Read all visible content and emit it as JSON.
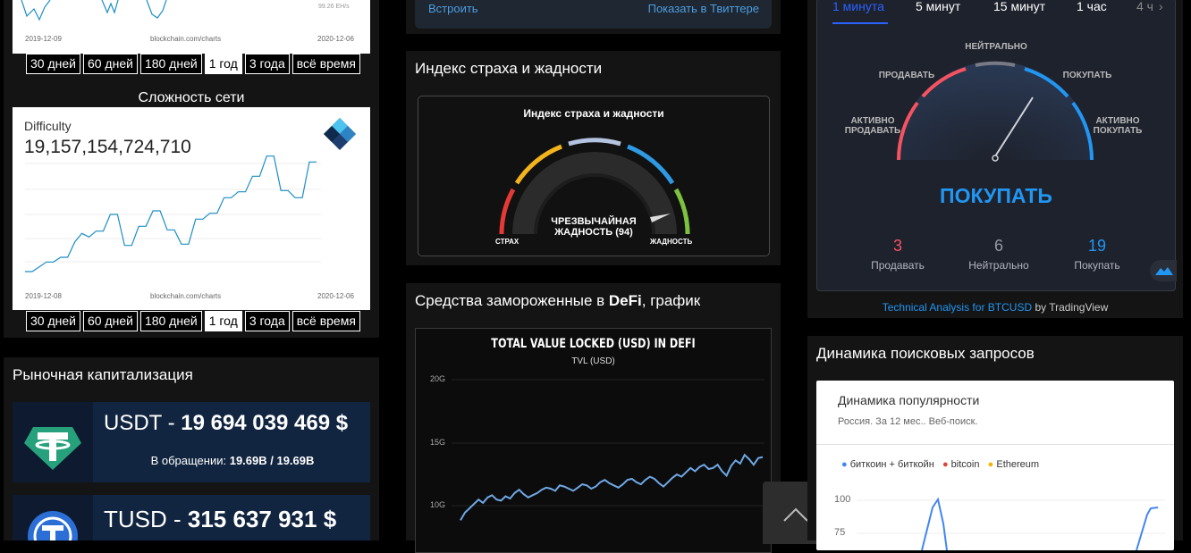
{
  "hashrate": {
    "value_text": "99.26 EH/s",
    "date_start": "2019-12-09",
    "source": "blockchain.com/charts",
    "date_end": "2020-12-06"
  },
  "timeframes": [
    "30 дней",
    "60 дней",
    "180 дней",
    "1 год",
    "3 года",
    "всё время"
  ],
  "timeframe_active": "1 год",
  "difficulty": {
    "section_title": "Сложность сети",
    "label": "Difficulty",
    "value": "19,157,154,724,710",
    "date_start": "2019-12-08",
    "source": "blockchain.com/charts",
    "date_end": "2020-12-06"
  },
  "market_cap": {
    "title": "Рыночная капитализация",
    "coins": [
      {
        "ticker": "USDT",
        "separator": " - ",
        "cap": "19 694 039 469 $",
        "circ_label": "В обращении:",
        "circ_value": "19.69B / 19.69B",
        "color": "#26a17b"
      },
      {
        "ticker": "TUSD",
        "separator": " - ",
        "cap": "315 637 931 $",
        "color": "#2b6fd6"
      }
    ]
  },
  "tweet": {
    "embed": "Встроить",
    "share": "Показать в Твиттере"
  },
  "fear_greed": {
    "title": "Индекс страха и жадности",
    "widget_title": "Индекс страха и жадности",
    "state_line1": "ЧРЕЗВЫЧАЙНАЯ",
    "state_line2": "ЖАДНОСТЬ (94)",
    "value": 94,
    "label_left": "СТРАХ",
    "label_right": "ЖАДНОСТЬ"
  },
  "defi": {
    "title_prefix": "Средства замороженные в ",
    "title_bold": "DeFi",
    "title_suffix": ", график",
    "chart_title": "TOTAL VALUE LOCKED (USD) IN DEFI",
    "chart_subtitle": "TVL (USD)",
    "ticks": [
      "20G",
      "15G",
      "10G"
    ]
  },
  "chart_data": [
    {
      "type": "line",
      "title": "TOTAL VALUE LOCKED (USD) IN DEFI",
      "subtitle": "TVL (USD)",
      "ylim": [
        7,
        22
      ],
      "yticks": [
        "20G",
        "15G",
        "10G"
      ],
      "values": [
        9.1,
        9.8,
        10.2,
        10.6,
        11.0,
        10.7,
        11.2,
        11.4,
        11.0,
        10.9,
        11.3,
        11.1,
        11.6,
        11.9,
        11.5,
        11.2,
        11.4,
        11.6,
        11.9,
        12.1,
        12.0,
        11.8,
        12.3,
        12.2,
        12.0,
        11.8,
        12.1,
        12.4,
        12.3,
        12.0,
        12.2,
        12.6,
        12.8,
        12.5,
        12.3,
        12.1,
        12.4,
        12.8,
        12.9,
        12.6,
        12.4,
        12.8,
        13.1,
        12.9,
        12.5,
        12.2,
        12.6,
        13.0,
        13.3,
        13.1,
        13.5,
        13.9,
        13.6,
        14.0,
        14.2,
        13.8,
        13.9,
        14.2,
        13.6,
        13.2,
        14.1,
        14.6,
        14.3,
        15.1,
        14.7,
        14.2,
        14.8,
        14.9
      ]
    },
    {
      "type": "line",
      "title": "Difficulty",
      "xlabels": [
        "2019-12-08",
        "2020-12-06"
      ],
      "ylim": [
        9,
        21
      ],
      "values": [
        10.2,
        10.2,
        10.6,
        11.0,
        11.0,
        11.4,
        11.4,
        12.7,
        13.4,
        13.1,
        13.6,
        13.6,
        15.0,
        15.0,
        12.4,
        12.4,
        14.0,
        14.0,
        15.3,
        15.3,
        13.7,
        13.7,
        12.5,
        12.5,
        14.6,
        14.6,
        15.1,
        15.1,
        16.4,
        16.4,
        16.9,
        16.9,
        18.2,
        18.2,
        19.9,
        19.9,
        17.0,
        17.0,
        16.4,
        16.4,
        19.4,
        19.4
      ]
    }
  ],
  "tv": {
    "tabs": [
      "1 минута",
      "5 минут",
      "15 минут",
      "1 час",
      "4 ч"
    ],
    "active_tab": "1 минута",
    "labels": {
      "neutral": "НЕЙТРАЛЬНО",
      "sell": "ПРОДАВАТЬ",
      "buy": "ПОКУПАТЬ",
      "strong_sell_1": "АКТИВНО",
      "strong_sell_2": "ПРОДАВАТЬ",
      "strong_buy_1": "АКТИВНО",
      "strong_buy_2": "ПОКУПАТЬ"
    },
    "signal": "ПОКУПАТЬ",
    "counts": [
      {
        "value": "3",
        "label": "Продавать",
        "color": "#f7525f"
      },
      {
        "value": "6",
        "label": "Нейтрально",
        "color": "#9598a1"
      },
      {
        "value": "19",
        "label": "Покупать",
        "color": "#2196f3"
      }
    ],
    "footer_link": "Technical Analysis for BTCUSD",
    "footer_by": " by TradingView"
  },
  "trends": {
    "title": "Динамика поисковых запросов",
    "card_title": "Динамика популярности",
    "card_subtitle": "Россия. За 12 мес.. Веб-поиск.",
    "legend": [
      {
        "label": "биткоин + биткойн",
        "color": "#4285f4"
      },
      {
        "label": "bitcoin",
        "color": "#db4437"
      },
      {
        "label": "Ethereum",
        "color": "#f4b400"
      }
    ],
    "ticks": [
      "100",
      "75"
    ]
  }
}
